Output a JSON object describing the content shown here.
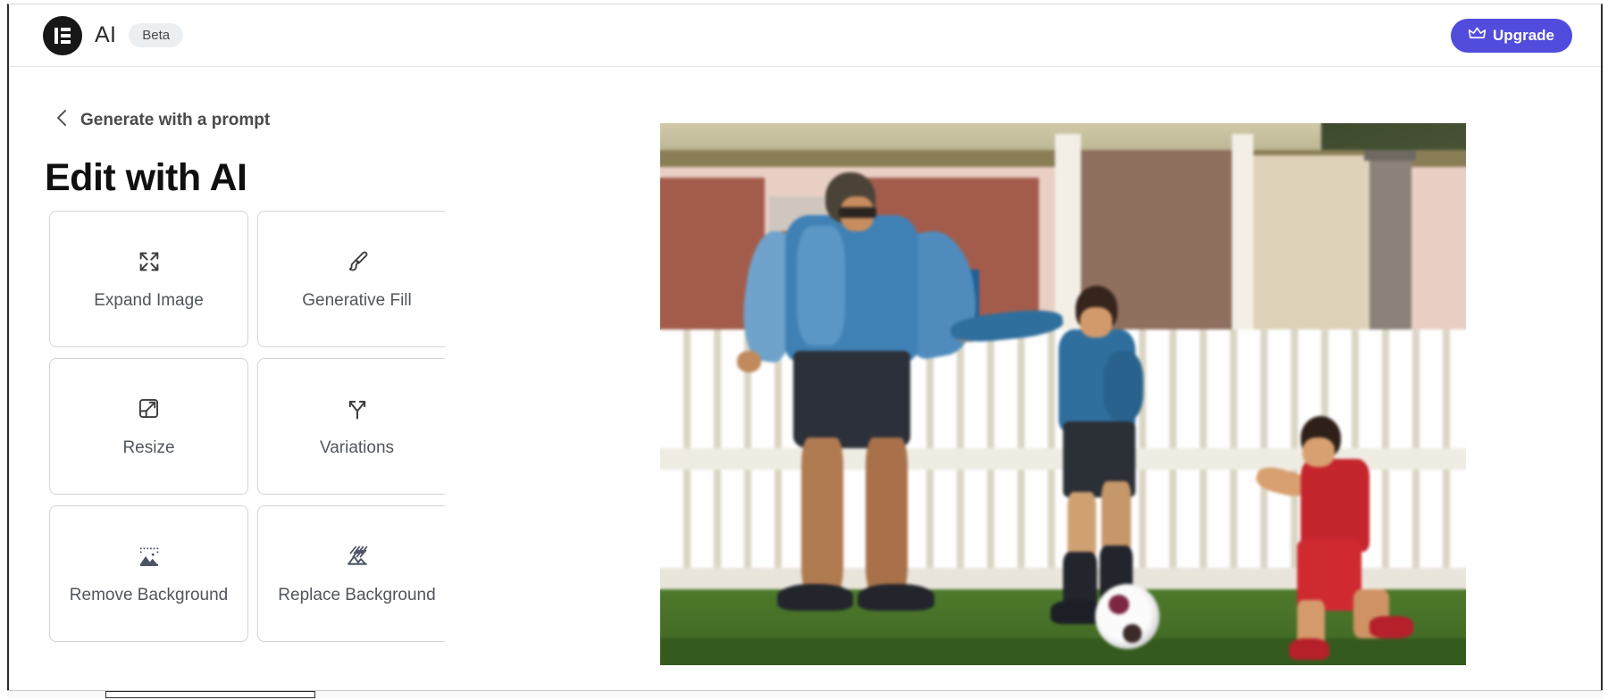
{
  "header": {
    "logo_icon": "elementor-logo-icon",
    "brand": "AI",
    "badge": "Beta",
    "upgrade": {
      "label": "Upgrade",
      "icon": "crown-icon",
      "color": "#524cdd"
    }
  },
  "sidebar": {
    "back_link": {
      "icon": "chevron-left-icon",
      "label": "Generate with a prompt"
    },
    "title": "Edit with AI",
    "cards": [
      {
        "label": "Expand Image",
        "icon": "expand-arrows-icon"
      },
      {
        "label": "Generative Fill",
        "icon": "paint-brush-icon"
      },
      {
        "label": "Resize",
        "icon": "resize-frame-icon"
      },
      {
        "label": "Variations",
        "icon": "branch-arrows-icon"
      },
      {
        "label": "Remove Background",
        "icon": "remove-background-icon"
      },
      {
        "label": "Replace Background",
        "icon": "replace-background-icon"
      }
    ]
  },
  "canvas": {
    "image": {
      "name": "preview-image",
      "description": "Man in blue training top reaching toward a boy in a blue kit kicking a white soccer ball on grass, a younger boy in a red kit running at right, white picket fence and house behind."
    }
  },
  "scrollbar": {
    "orientation": "horizontal"
  }
}
